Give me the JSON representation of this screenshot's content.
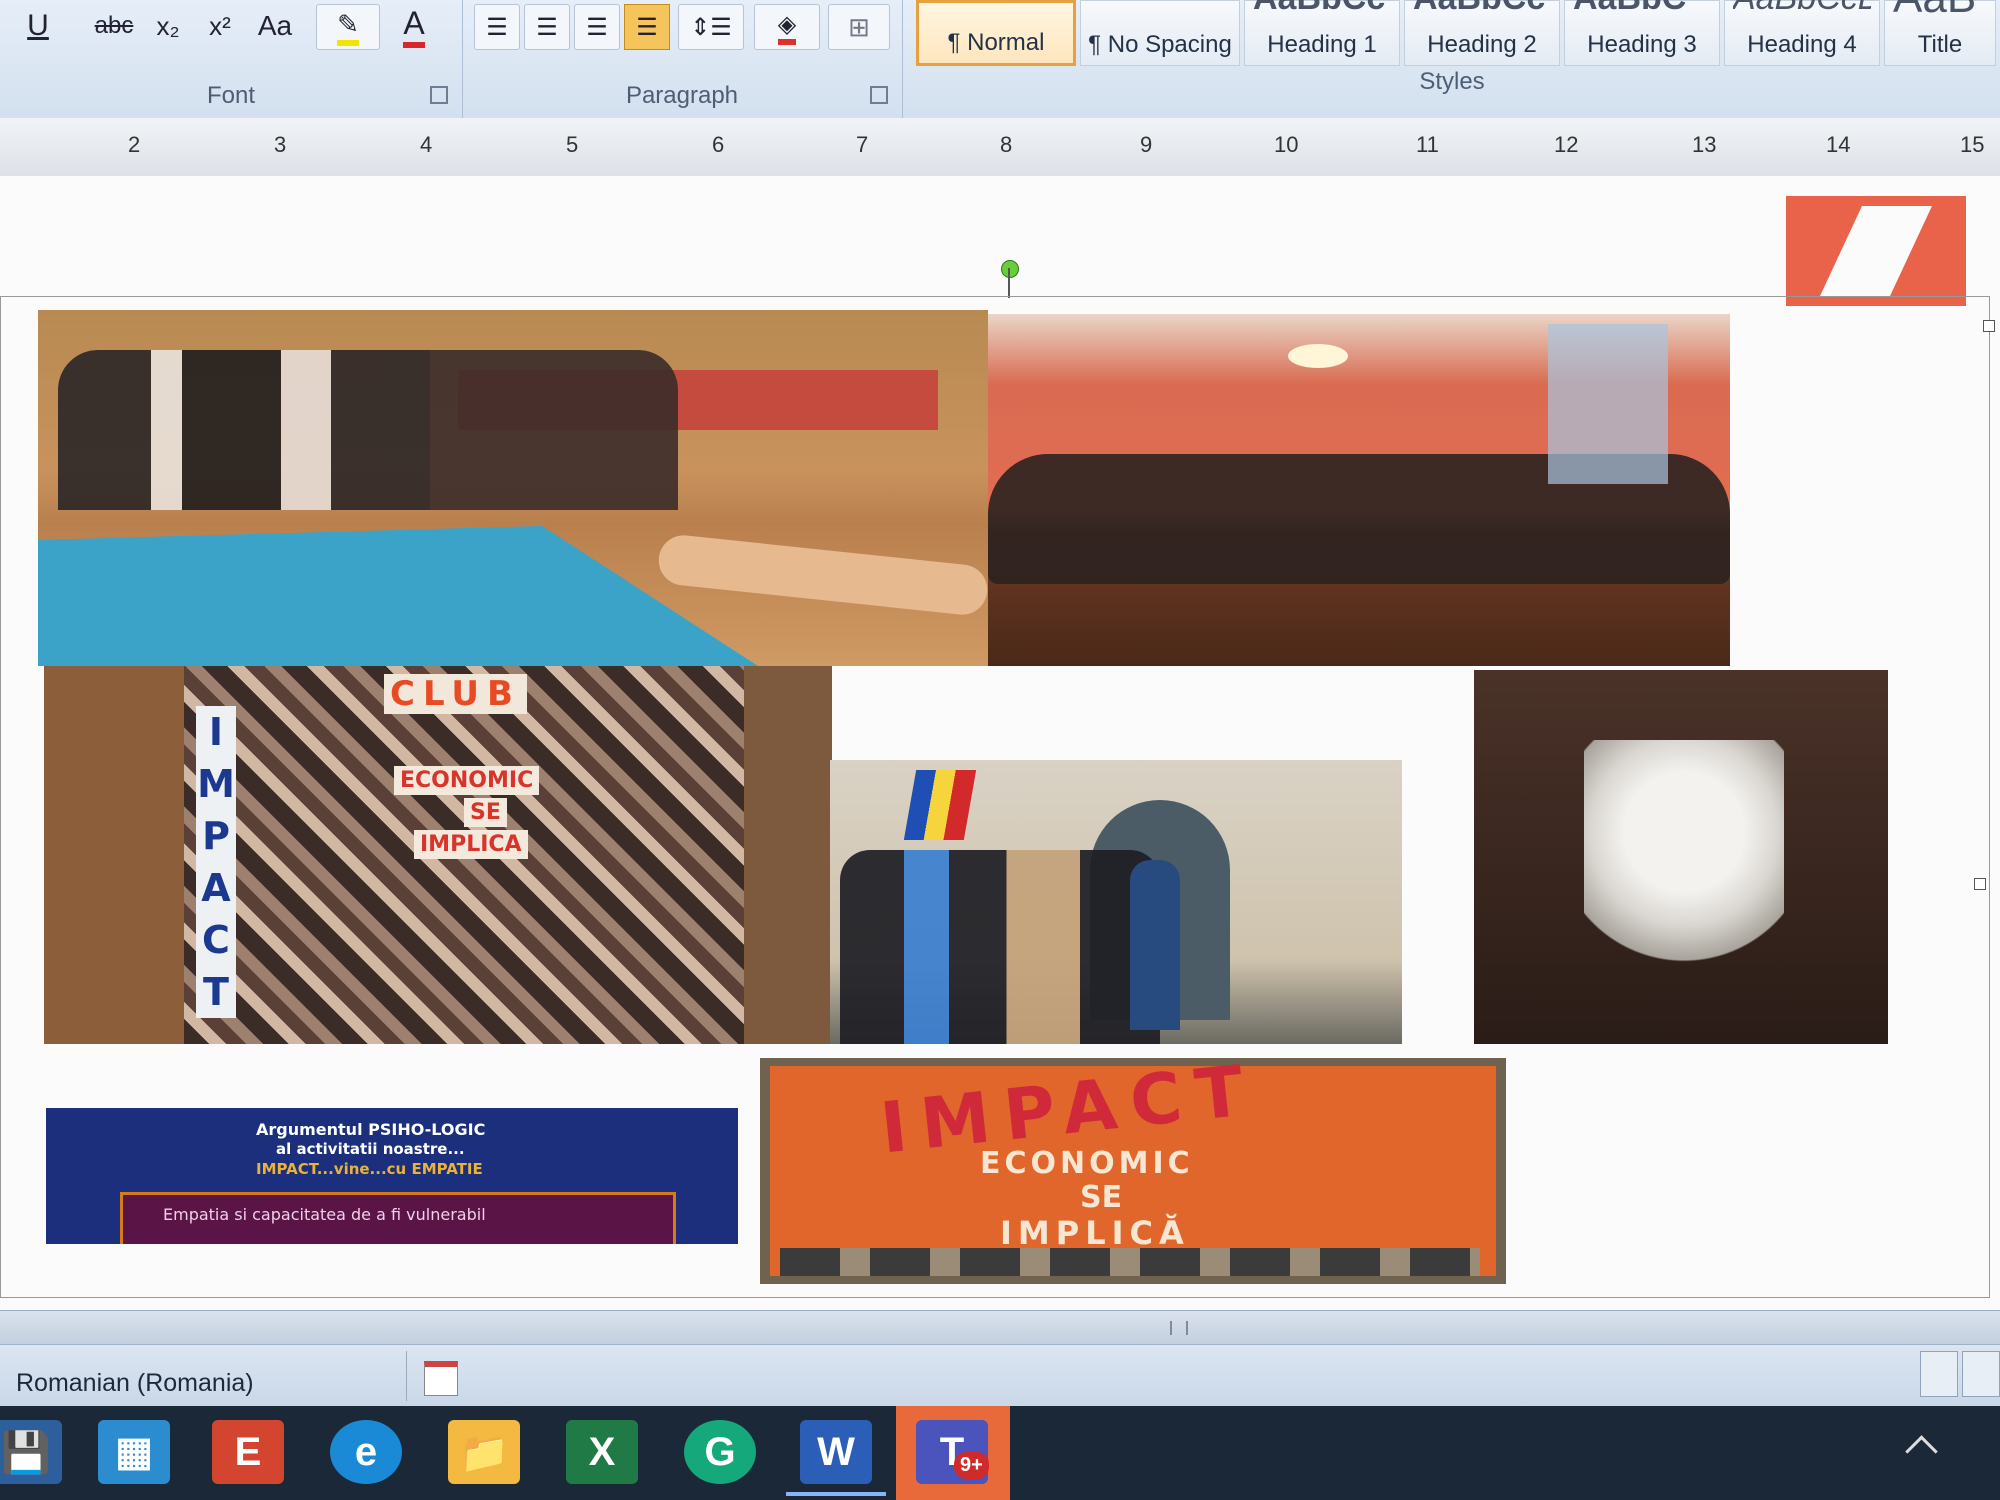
{
  "ribbon": {
    "font_group": {
      "label": "Font",
      "buttons": [
        "U",
        "abc",
        "x₂",
        "x²",
        "Aa",
        "A"
      ]
    },
    "paragraph_group": {
      "label": "Paragraph"
    },
    "styles_group": {
      "label": "Styles",
      "tiles": [
        {
          "preview": "",
          "label": "¶ Normal"
        },
        {
          "preview": "",
          "label": "¶ No Spacing"
        },
        {
          "preview": "AaBbCc",
          "label": "Heading 1"
        },
        {
          "preview": "AaBbCc",
          "label": "Heading 2"
        },
        {
          "preview": "AaBbC",
          "label": "Heading 3"
        },
        {
          "preview": "AaBbCcD",
          "label": "Heading 4"
        },
        {
          "preview": "AaB",
          "label": "Title"
        }
      ]
    }
  },
  "ruler": {
    "numbers": [
      "2",
      "3",
      "4",
      "5",
      "6",
      "7",
      "8",
      "9",
      "10",
      "11",
      "12",
      "13",
      "14",
      "15"
    ]
  },
  "document": {
    "images": [
      {
        "name": "photo-students-circle",
        "caption": ""
      },
      {
        "name": "photo-meeting-room",
        "caption": ""
      },
      {
        "name": "photo-impact-club-board",
        "caption": ""
      },
      {
        "name": "photo-school-entrance-group",
        "caption": ""
      },
      {
        "name": "photo-paper-decoration",
        "caption": ""
      },
      {
        "name": "slide-psycho-logic",
        "caption": ""
      },
      {
        "name": "poster-impact",
        "caption": ""
      }
    ],
    "board_text": {
      "club": "CLUB",
      "impact_vertical": "IMPACT",
      "economic": "ECONOMIC",
      "se": "SE",
      "implica": "IMPLICA"
    },
    "slide_text": {
      "title_line1": "Argumentul PSIHO-LOGIC",
      "title_line2": "al activitatii noastre...",
      "title_line3": "IMPACT...vine...cu EMPATIE",
      "box_line": "Empatia si capacitatea de a fi vulnerabil"
    },
    "poster_text": {
      "big": "IMPACT",
      "line1": "ECONOMIC",
      "line2": "SE",
      "line3": "IMPLICĂ"
    }
  },
  "status": {
    "language": "Romanian (Romania)"
  },
  "taskbar": {
    "icons": [
      {
        "name": "save-icon",
        "glyph": "💾"
      },
      {
        "name": "app-icon",
        "glyph": "▦"
      },
      {
        "name": "powerpoint-icon",
        "glyph": "E"
      },
      {
        "name": "edge-icon",
        "glyph": "e"
      },
      {
        "name": "file-explorer-icon",
        "glyph": "📁"
      },
      {
        "name": "excel-icon",
        "glyph": "X"
      },
      {
        "name": "grammarly-icon",
        "glyph": "G"
      },
      {
        "name": "word-icon",
        "glyph": "W"
      },
      {
        "name": "teams-icon",
        "glyph": "T"
      }
    ],
    "teams_badge": "9+"
  },
  "colors": {
    "accent": "#e7a040",
    "teams": "#e86a3a",
    "poster_orange": "#e0662c"
  }
}
